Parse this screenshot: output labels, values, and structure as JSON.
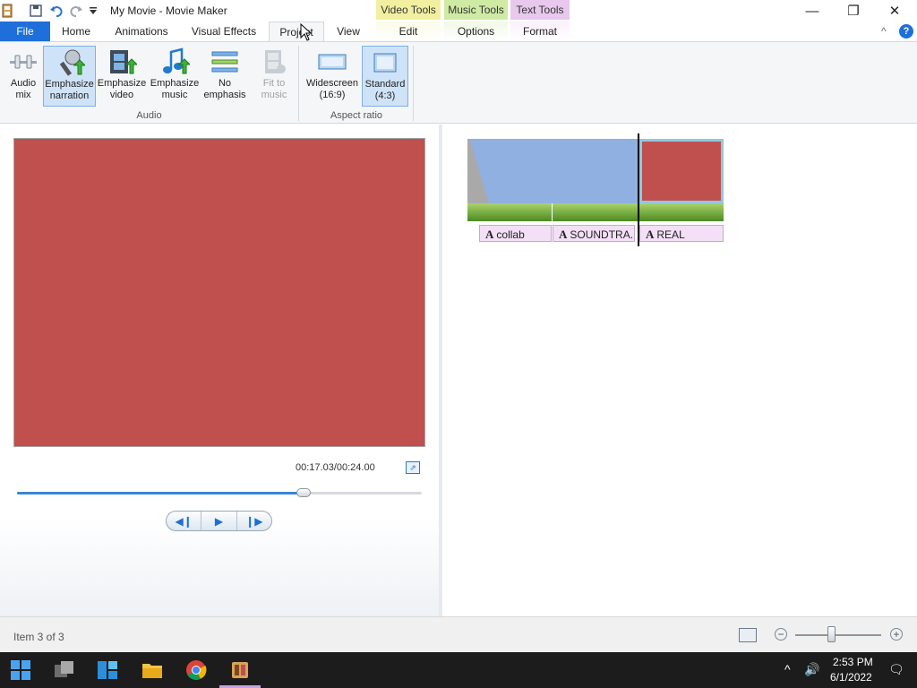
{
  "window": {
    "title": "My Movie - Movie Maker",
    "minimize_glyph": "—",
    "maximize_glyph": "❐",
    "close_glyph": "✕",
    "quick_access_icons": [
      "app-icon",
      "save-icon",
      "undo-icon",
      "redo-icon",
      "customize-dropdown-icon"
    ]
  },
  "contextual_tabs": {
    "video_tools": "Video Tools",
    "music_tools": "Music Tools",
    "text_tools": "Text Tools"
  },
  "tabs": {
    "file": "File",
    "home": "Home",
    "animations": "Animations",
    "visual_effects": "Visual Effects",
    "project": "Project",
    "view": "View",
    "edit": "Edit",
    "options": "Options",
    "format": "Format",
    "active": "Project"
  },
  "ribbon": {
    "audio_group_label": "Audio",
    "aspect_group_label": "Aspect ratio",
    "audio_mix": {
      "line1": "Audio",
      "line2": "mix"
    },
    "emphasize_narration": {
      "line1": "Emphasize",
      "line2": "narration"
    },
    "emphasize_video": {
      "line1": "Emphasize",
      "line2": "video"
    },
    "emphasize_music": {
      "line1": "Emphasize",
      "line2": "music"
    },
    "no_emphasis": {
      "line1": "No",
      "line2": "emphasis"
    },
    "fit_to_music": {
      "line1": "Fit to",
      "line2": "music"
    },
    "widescreen": {
      "line1": "Widescreen",
      "line2": "(16:9)"
    },
    "standard": {
      "line1": "Standard",
      "line2": "(4:3)"
    }
  },
  "preview": {
    "background_color": "#c0504d",
    "timecode": "00:17.03/00:24.00",
    "seek_fraction": 0.709
  },
  "storyboard": {
    "captions": [
      "collab",
      "SOUNDTRA...",
      "REAL"
    ],
    "caption_glyph": "A"
  },
  "status": {
    "item_text": "Item 3 of 3",
    "zoom_fraction": 0.42,
    "zoom_out_glyph": "−",
    "zoom_in_glyph": "+"
  },
  "taskbar": {
    "time": "2:53 PM",
    "date": "6/1/2022",
    "tray_chevron": "^",
    "tray_volume": "🔊",
    "tray_notifications": "🗨"
  },
  "colors": {
    "accent": "#1e6fd9",
    "clip_red": "#c0504d",
    "clip_blue": "#8fb0e0",
    "caption_bg": "#f3dff6"
  }
}
